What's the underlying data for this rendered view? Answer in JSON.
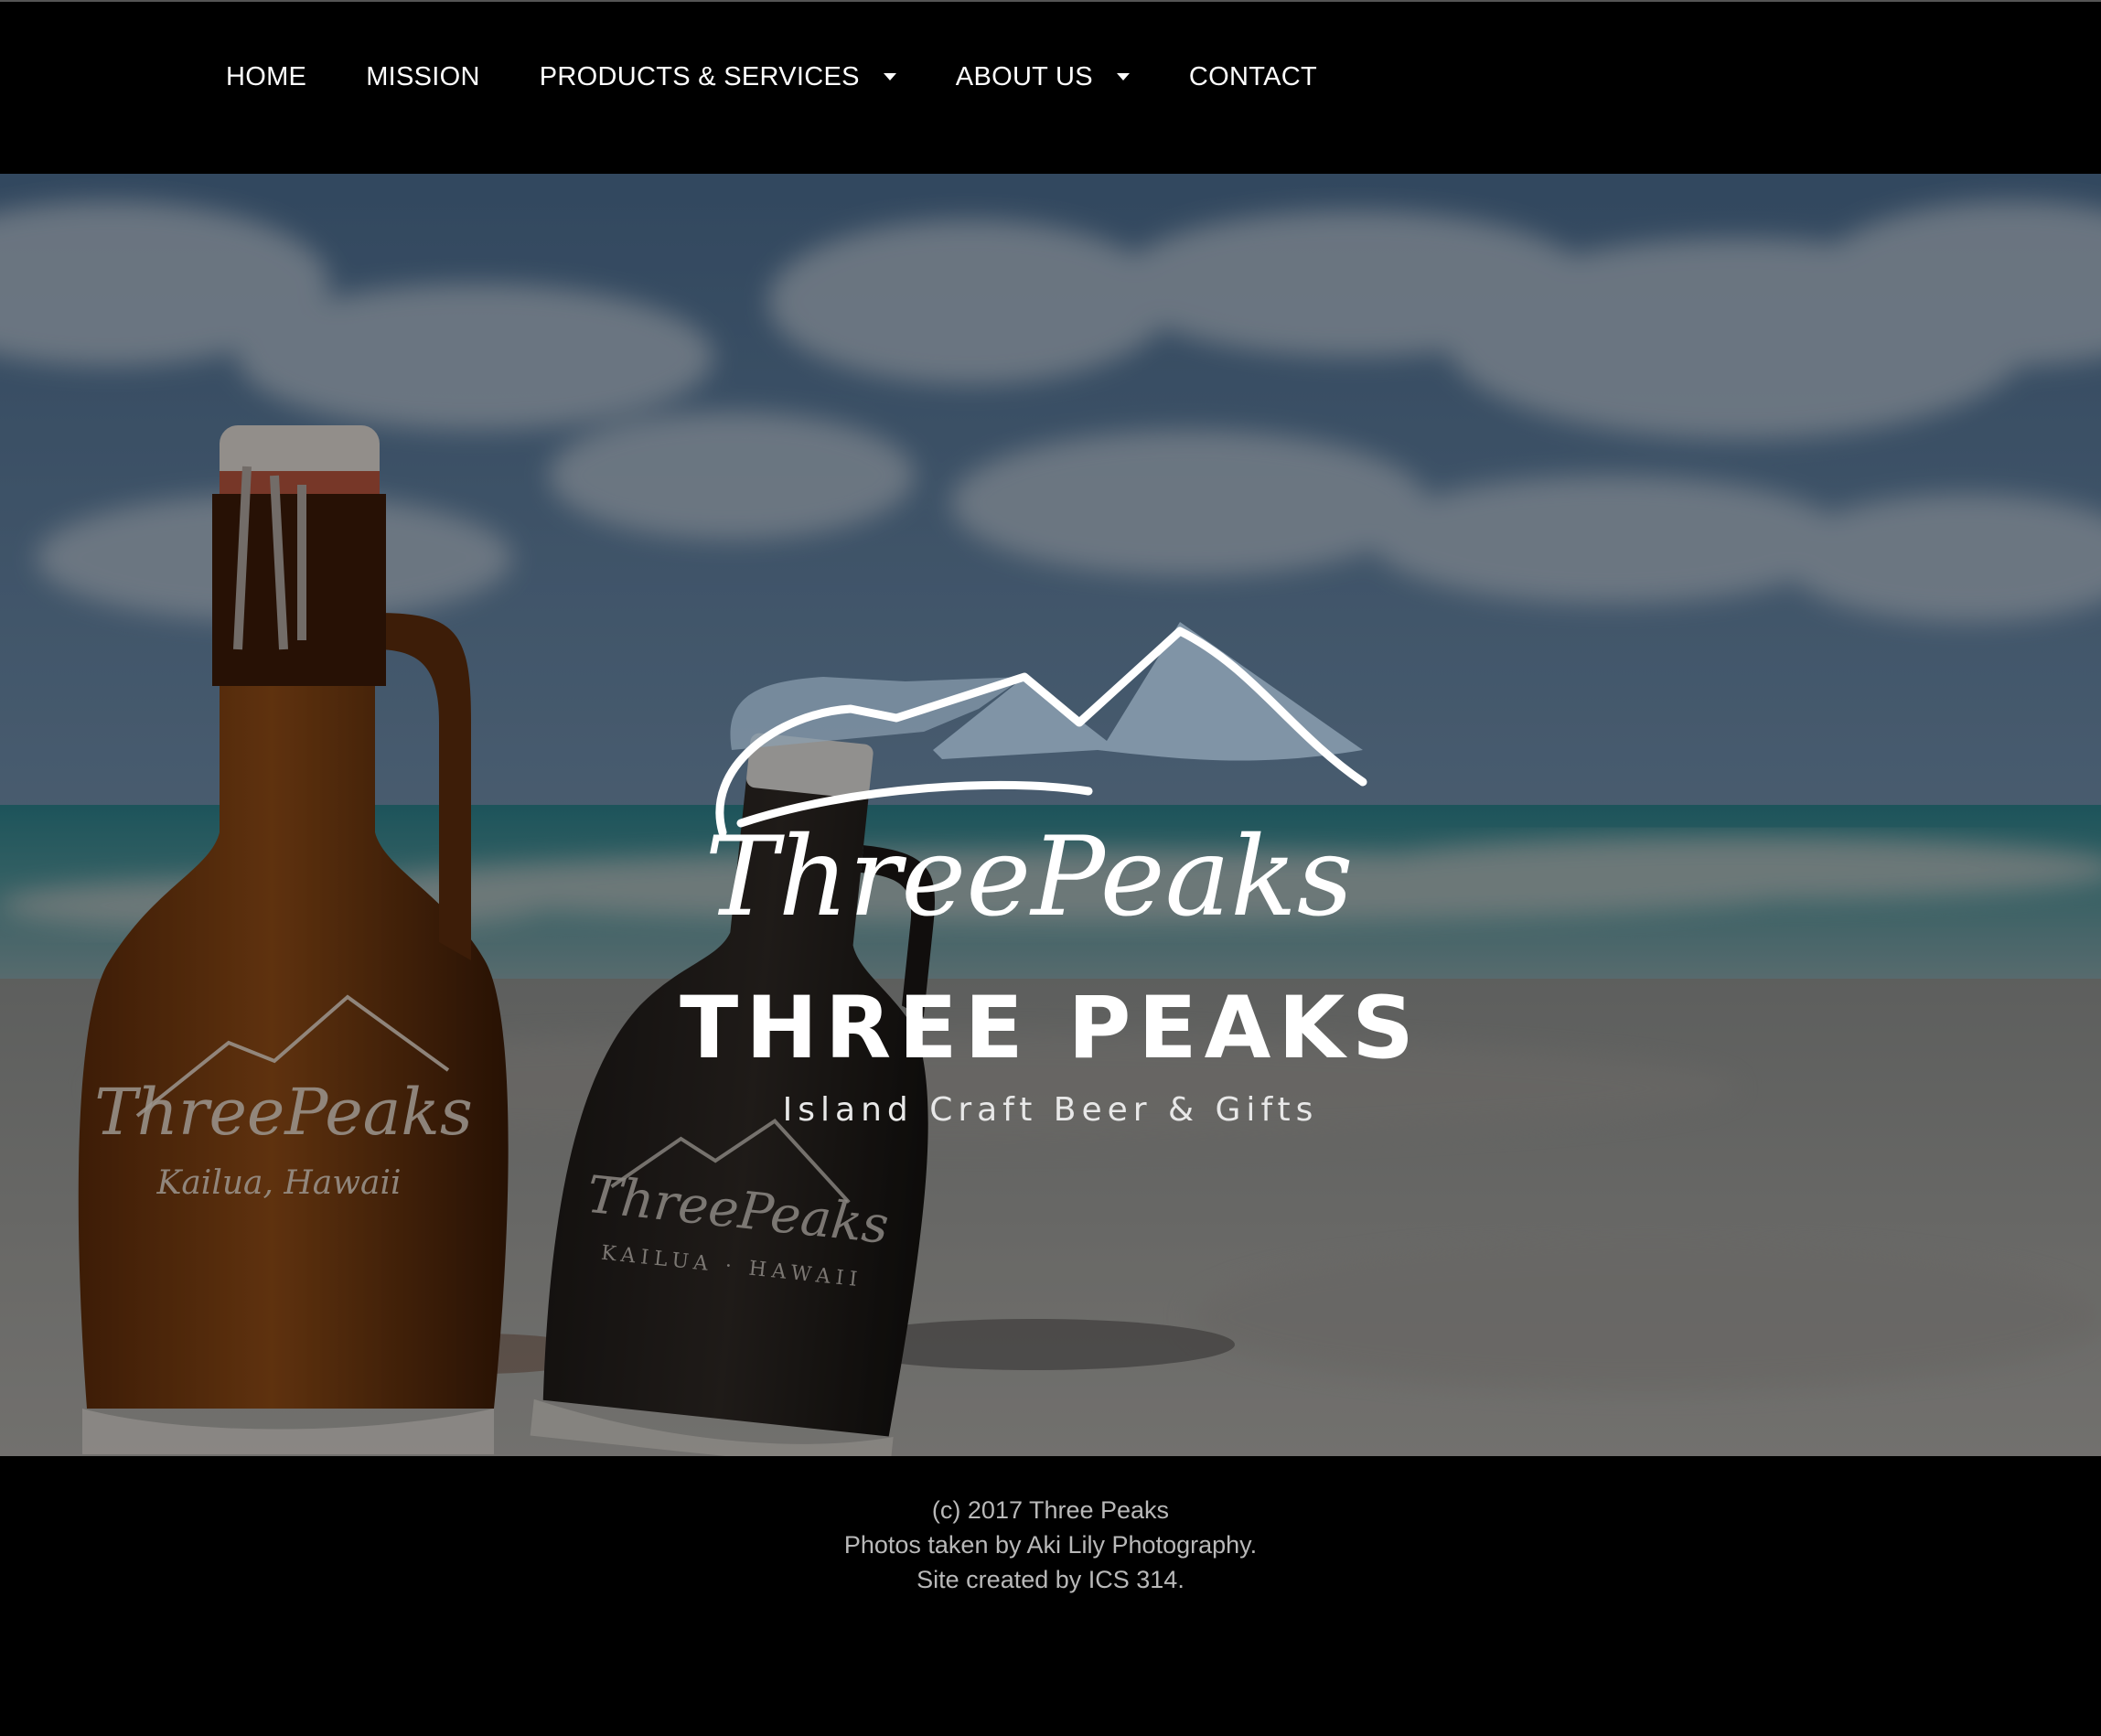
{
  "nav": {
    "items": [
      {
        "label": "HOME"
      },
      {
        "label": "MISSION"
      },
      {
        "label": "PRODUCTS & SERVICES"
      },
      {
        "label": "ABOUT US"
      },
      {
        "label": "CONTACT"
      }
    ]
  },
  "hero": {
    "logo_script": "ThreePeaks",
    "brand": "THREE PEAKS",
    "tagline": "Island Craft Beer & Gifts",
    "left_bottle_text": "ThreePeaks",
    "left_bottle_subtext": "Kailua, Hawaii",
    "right_bottle_text": "ThreePeaks",
    "right_bottle_subtext": "KAILUA · HAWAII"
  },
  "footer": {
    "line1": "(c) 2017 Three Peaks",
    "line2": "Photos taken by Aki Lily Photography.",
    "line3": "Site created by ICS 314."
  },
  "colors": {
    "nav_bg": "#000000",
    "nav_text": "#ffffff",
    "footer_text": "#b9b9b9"
  },
  "icons": {
    "dropdown": "caret-down-icon",
    "logo": "mountain-peaks-logo"
  }
}
